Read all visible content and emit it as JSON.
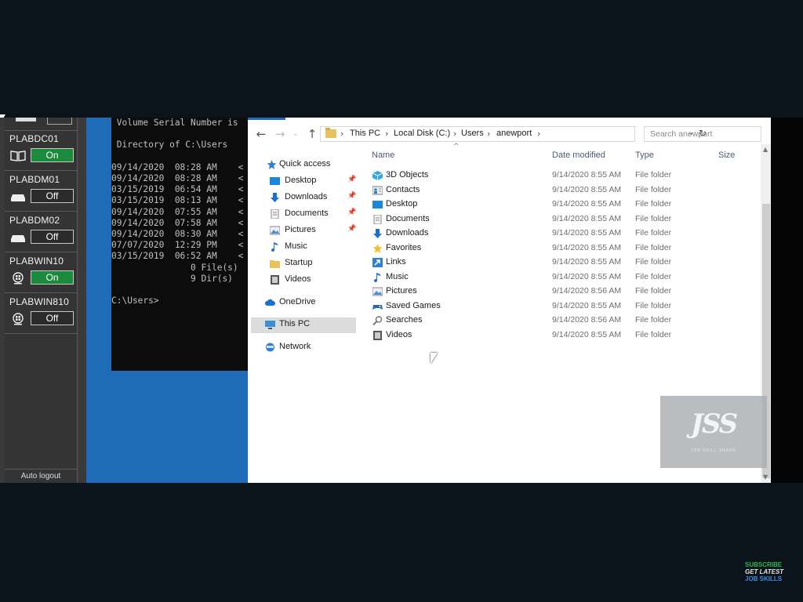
{
  "vm_panel": {
    "machines": [
      {
        "name": "PLABDC01",
        "state": "On",
        "icon": "server-book-icon"
      },
      {
        "name": "PLABDM01",
        "state": "Off",
        "icon": "drive-icon"
      },
      {
        "name": "PLABDM02",
        "state": "Off",
        "icon": "drive-icon"
      },
      {
        "name": "PLABWIN10",
        "state": "On",
        "icon": "windows-pc-icon"
      },
      {
        "name": "PLABWIN810",
        "state": "Off",
        "icon": "windows-pc-icon"
      }
    ],
    "auto_logout": "Auto logout"
  },
  "terminal": {
    "lines": [
      " Volume Serial Number is",
      "",
      " Directory of C:\\Users",
      "",
      "09/14/2020  08:28 AM    <",
      "09/14/2020  08:28 AM    <",
      "03/15/2019  06:54 AM    <",
      "03/15/2019  08:13 AM    <",
      "09/14/2020  07:55 AM    <",
      "09/14/2020  07:58 AM    <",
      "09/14/2020  08:30 AM    <",
      "07/07/2020  12:29 PM    <",
      "03/15/2019  06:52 AM    <",
      "               0 File(s)",
      "               9 Dir(s)",
      "",
      "C:\\Users>"
    ]
  },
  "explorer": {
    "breadcrumbs": [
      "This PC",
      "Local Disk (C:)",
      "Users",
      "anewport"
    ],
    "search_placeholder": "Search anewport",
    "nav": {
      "quick_access": "Quick access",
      "items": [
        "Desktop",
        "Downloads",
        "Documents",
        "Pictures",
        "Music",
        "Startup",
        "Videos"
      ],
      "onedrive": "OneDrive",
      "this_pc": "This PC",
      "network": "Network"
    },
    "columns": {
      "name": "Name",
      "date": "Date modified",
      "type": "Type",
      "size": "Size"
    },
    "files": [
      {
        "name": "3D Objects",
        "date": "9/14/2020 8:55 AM",
        "type": "File folder",
        "icon": "3d-objects-icon"
      },
      {
        "name": "Contacts",
        "date": "9/14/2020 8:55 AM",
        "type": "File folder",
        "icon": "contacts-icon"
      },
      {
        "name": "Desktop",
        "date": "9/14/2020 8:55 AM",
        "type": "File folder",
        "icon": "desktop-icon"
      },
      {
        "name": "Documents",
        "date": "9/14/2020 8:55 AM",
        "type": "File folder",
        "icon": "documents-icon"
      },
      {
        "name": "Downloads",
        "date": "9/14/2020 8:55 AM",
        "type": "File folder",
        "icon": "downloads-icon"
      },
      {
        "name": "Favorites",
        "date": "9/14/2020 8:55 AM",
        "type": "File folder",
        "icon": "favorites-icon"
      },
      {
        "name": "Links",
        "date": "9/14/2020 8:55 AM",
        "type": "File folder",
        "icon": "links-icon"
      },
      {
        "name": "Music",
        "date": "9/14/2020 8:55 AM",
        "type": "File folder",
        "icon": "music-icon"
      },
      {
        "name": "Pictures",
        "date": "9/14/2020 8:56 AM",
        "type": "File folder",
        "icon": "pictures-icon"
      },
      {
        "name": "Saved Games",
        "date": "9/14/2020 8:55 AM",
        "type": "File folder",
        "icon": "saved-games-icon"
      },
      {
        "name": "Searches",
        "date": "9/14/2020 8:56 AM",
        "type": "File folder",
        "icon": "searches-icon"
      },
      {
        "name": "Videos",
        "date": "9/14/2020 8:55 AM",
        "type": "File folder",
        "icon": "videos-icon"
      }
    ]
  },
  "watermark": {
    "logo": "JSS",
    "tagline": "JOB SKILL SHARE"
  },
  "subscribe": {
    "line1": "SUBSCRIBE",
    "line2": "GET LATEST",
    "line3": "JOB SKILLS"
  },
  "colors": {
    "on": "#1c8a3c",
    "off": "#2b2b2b",
    "desktop_blue": "#1e6cb8",
    "folder": "#e8c25c"
  }
}
